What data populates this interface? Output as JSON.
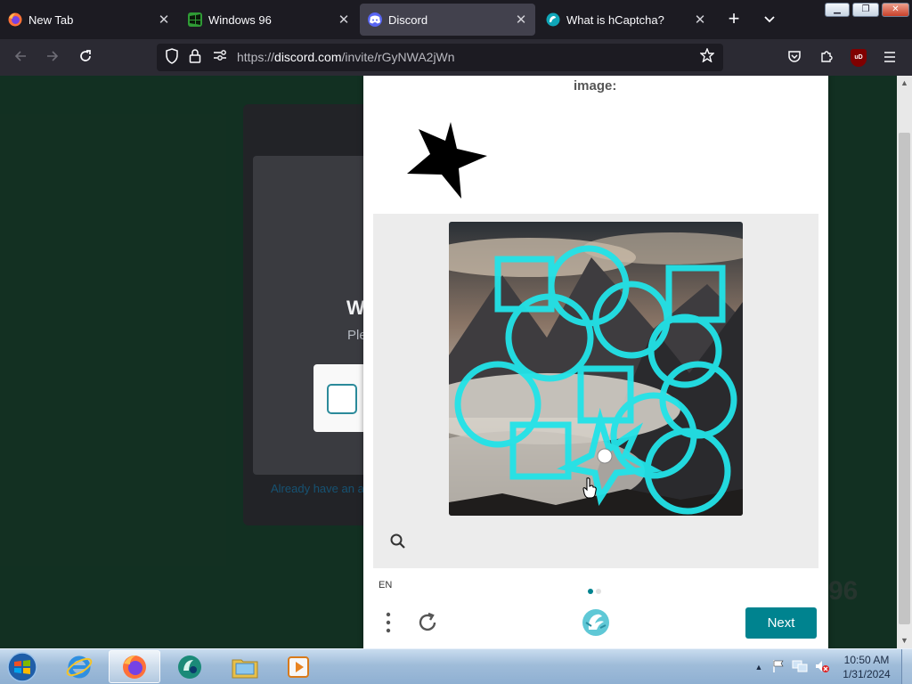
{
  "browser": {
    "tabs": [
      {
        "title": "New Tab",
        "icon": "firefox-icon",
        "active": false
      },
      {
        "title": "Windows 96",
        "icon": "windows96-icon",
        "active": false
      },
      {
        "title": "Discord",
        "icon": "discord-icon",
        "active": true
      },
      {
        "title": "What is hCaptcha?",
        "icon": "hcaptcha-icon",
        "active": false
      }
    ],
    "new_tab_symbol": "+",
    "tab_list_symbol": "⌵",
    "url_scheme": "https://",
    "url_host": "discord.com",
    "url_path": "/invite/rGyNWA2jWn",
    "ublock_label": "uD",
    "window_controls": {
      "minimize": "▁",
      "restore": "❐",
      "close": "✕"
    }
  },
  "page": {
    "heading_partial": "W",
    "subtext_partial": "Ple",
    "login_link_partial": "Already have an a",
    "watermark_partial": "96"
  },
  "captcha": {
    "prompt_partial": "image:",
    "language": "EN",
    "next_label": "Next",
    "pager": {
      "total": 2,
      "current": 1
    },
    "accent_color": "#00838f"
  },
  "taskbar": {
    "pinned": [
      "internet-explorer-icon",
      "firefox-icon",
      "media-center-icon",
      "file-explorer-icon",
      "media-player-icon"
    ],
    "active_item": "firefox-icon",
    "clock_time": "10:50 AM",
    "clock_date": "1/31/2024"
  }
}
